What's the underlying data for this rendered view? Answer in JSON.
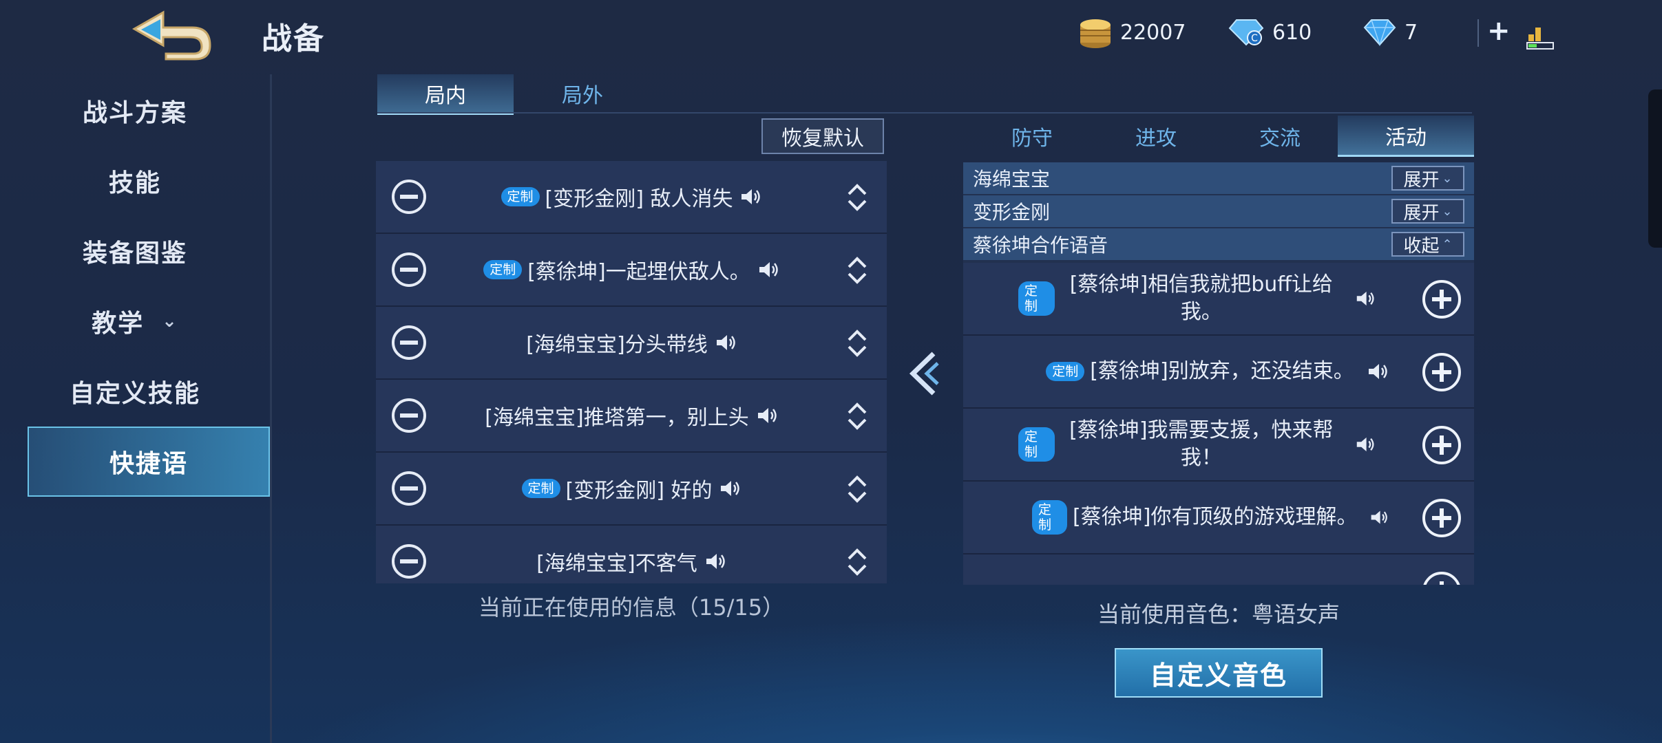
{
  "header": {
    "title": "战备",
    "gold": "22007",
    "voucher": "610",
    "diamond": "7"
  },
  "sidebar": {
    "items": [
      {
        "label": "战斗方案"
      },
      {
        "label": "技能"
      },
      {
        "label": "装备图鉴"
      },
      {
        "label": "教学"
      },
      {
        "label": "自定义技能"
      },
      {
        "label": "快捷语"
      }
    ],
    "active": "快捷语"
  },
  "left_tabs": {
    "in_game": "局内",
    "out_game": "局外"
  },
  "reset_label": "恢复默认",
  "badge_label": "定制",
  "current_list": [
    {
      "text": "[变形金刚] 敌人消失",
      "custom": true
    },
    {
      "text": "[蔡徐坤]一起埋伏敌人。",
      "custom": true
    },
    {
      "text": "[海绵宝宝]分头带线",
      "custom": false
    },
    {
      "text": "[海绵宝宝]推塔第一，别上头",
      "custom": false
    },
    {
      "text": "[变形金刚] 好的",
      "custom": true
    },
    {
      "text": "[海绵宝宝]不客气",
      "custom": false
    }
  ],
  "left_status": "当前正在使用的信息（15/15）",
  "right_tabs": [
    {
      "label": "防守"
    },
    {
      "label": "进攻"
    },
    {
      "label": "交流"
    },
    {
      "label": "活动"
    }
  ],
  "right_active_tab": "活动",
  "categories": [
    {
      "label": "海绵宝宝",
      "button": "展开",
      "state": "collapsed"
    },
    {
      "label": "变形金刚",
      "button": "展开",
      "state": "collapsed"
    },
    {
      "label": "蔡徐坤合作语音",
      "button": "收起",
      "state": "expanded"
    }
  ],
  "available_list": [
    {
      "text": "[蔡徐坤]相信我就把buff让给我。",
      "custom": true
    },
    {
      "text": "[蔡徐坤]别放弃，还没结束。",
      "custom": true
    },
    {
      "text": "[蔡徐坤]我需要支援，快来帮我！",
      "custom": true
    },
    {
      "text": "[蔡徐坤]你有顶级的游戏理解。",
      "custom": true
    }
  ],
  "right_status": "当前使用音色：粤语女声",
  "custom_voice_button": "自定义音色",
  "colors": {
    "accent": "#1f8ee6",
    "active_tab": "#9fd8f5",
    "panel": "#26365a"
  }
}
